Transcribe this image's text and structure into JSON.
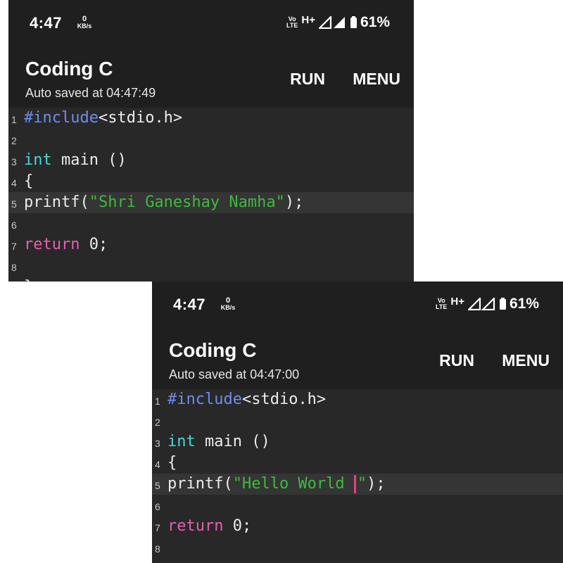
{
  "screens": [
    {
      "status": {
        "time": "4:47",
        "speed_value": "0",
        "speed_unit": "KB/s",
        "volte_top": "Vo",
        "volte_bottom": "LTE",
        "network": "H+",
        "battery": "61%"
      },
      "app": {
        "title": "Coding C",
        "subtitle": "Auto saved at 04:47:49",
        "run_label": "RUN",
        "menu_label": "MENU"
      },
      "editor": {
        "line_numbers": [
          "1",
          "2",
          "3",
          "4",
          "5",
          "6",
          "7",
          "8"
        ],
        "l1_directive": "#include",
        "l1_header": "<stdio.h>",
        "l3_type": "int",
        "l3_rest": " main ()",
        "l4_text": "{",
        "l5_fn": "printf(",
        "l5_string": "\"Shri Ganeshay Namha\"",
        "l5_end": ");",
        "l7_keyword": "return",
        "l7_rest": " 0;",
        "l9_partial": "}"
      }
    },
    {
      "status": {
        "time": "4:47",
        "speed_value": "0",
        "speed_unit": "KB/s",
        "volte_top": "Vo",
        "volte_bottom": "LTE",
        "network": "H+",
        "battery": "61%"
      },
      "app": {
        "title": "Coding C",
        "subtitle": "Auto saved at 04:47:00",
        "run_label": "RUN",
        "menu_label": "MENU"
      },
      "editor": {
        "line_numbers": [
          "1",
          "2",
          "3",
          "4",
          "5",
          "6",
          "7",
          "8"
        ],
        "l1_directive": "#include",
        "l1_header": "<stdio.h>",
        "l3_type": "int",
        "l3_rest": " main ()",
        "l4_text": "{",
        "l5_fn": "printf(",
        "l5_string_before_caret": "\"Hello World ",
        "l5_string_after_caret": "\"",
        "l5_end": ");",
        "l7_keyword": "return",
        "l7_rest": " 0;"
      }
    }
  ],
  "colors": {
    "background": "#1f1f1f",
    "editor_bg": "#282828",
    "current_line": "#353535",
    "directive": "#6d8ef0",
    "type": "#4fd4d4",
    "return_kw": "#e85fb0",
    "string": "#3dbb3d",
    "caret": "#e8407c"
  },
  "icons": [
    "volte-icon",
    "signal-icon",
    "battery-icon"
  ]
}
